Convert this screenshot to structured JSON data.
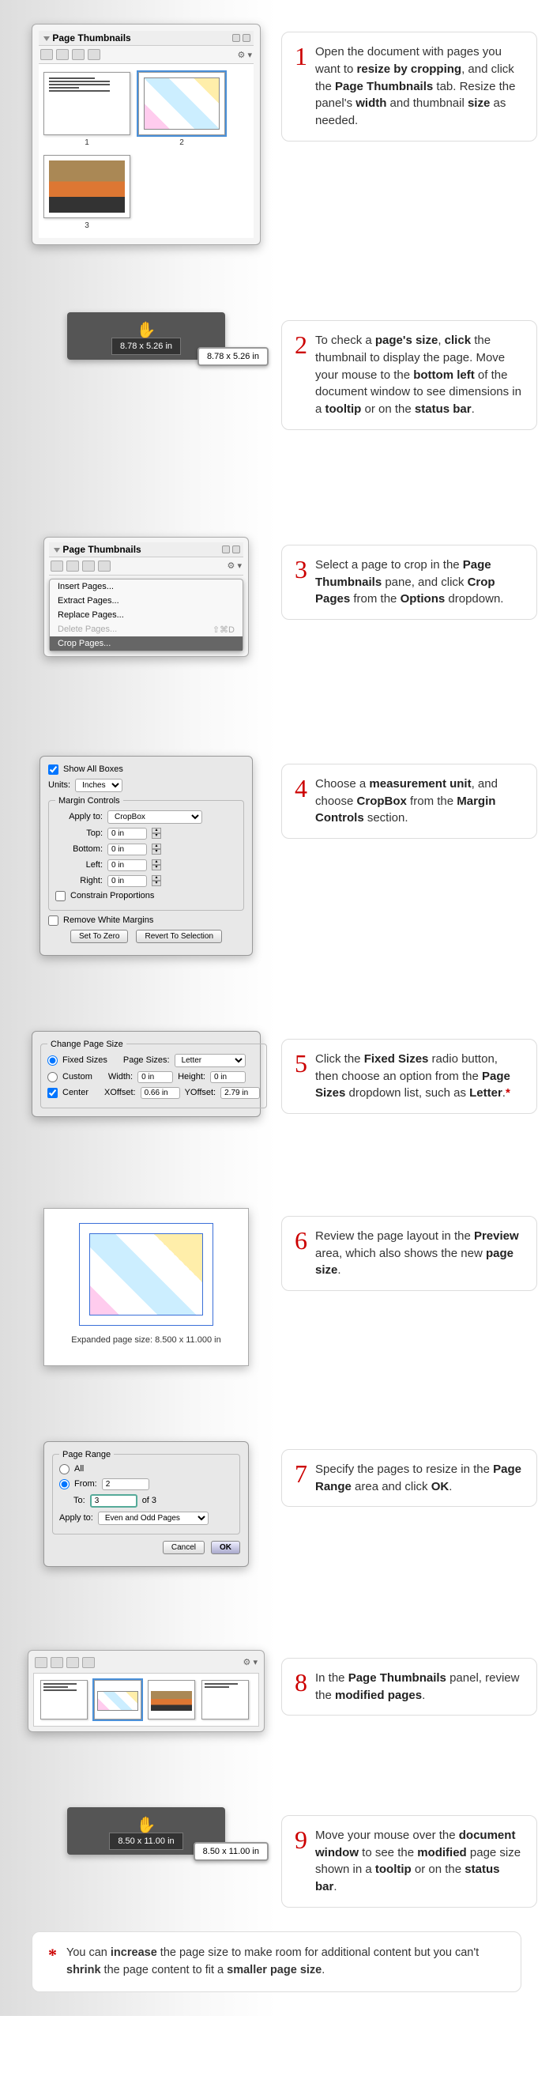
{
  "step1": {
    "panel_title": "Page Thumbnails",
    "thumb_labels": [
      "1",
      "2",
      "3"
    ],
    "text_parts": [
      "Open the document with pages you want to ",
      "resize by cropping",
      ", and click the ",
      "Page Thumbnails",
      " tab. Resize the panel's ",
      "width",
      " and thumbnail ",
      "size",
      " as needed."
    ]
  },
  "step2": {
    "status_size": "8.78 x 5.26 in",
    "tooltip_size": "8.78 x 5.26 in",
    "text_parts": [
      "To check a ",
      "page's size",
      ", ",
      "click",
      " the thumbnail to display the page. Move your mouse to the ",
      "bottom left",
      " of the document window to see dimensions in a ",
      "tooltip",
      " or on the ",
      "status bar",
      "."
    ]
  },
  "step3": {
    "panel_title": "Page Thumbnails",
    "menu_items": [
      "Insert Pages...",
      "Extract Pages...",
      "Replace Pages..."
    ],
    "menu_disabled": "Delete Pages...",
    "menu_shortcut": "⇧⌘D",
    "menu_highlight": "Crop Pages...",
    "text_parts": [
      "Select a page to crop in the ",
      "Page Thumbnails",
      " pane, and click ",
      "Crop Pages",
      " from the ",
      "Options",
      " dropdown."
    ]
  },
  "step4": {
    "checkbox_label": "Show All Boxes",
    "units_label": "Units:",
    "units_value": "Inches",
    "margin_legend": "Margin Controls",
    "apply_label": "Apply to:",
    "apply_value": "CropBox",
    "top_label": "Top:",
    "bottom_label": "Bottom:",
    "left_label": "Left:",
    "right_label": "Right:",
    "zero": "0 in",
    "constrain_label": "Constrain Proportions",
    "remove_white_label": "Remove White Margins",
    "btn_zero": "Set To Zero",
    "btn_revert": "Revert To Selection",
    "text_parts": [
      "Choose a ",
      "measurement unit",
      ", and choose ",
      "CropBox",
      " from the ",
      "Margin Controls",
      " section."
    ]
  },
  "step5": {
    "legend": "Change Page Size",
    "fixed_label": "Fixed Sizes",
    "page_sizes_label": "Page Sizes:",
    "page_sizes_value": "Letter",
    "custom_label": "Custom",
    "width_label": "Width:",
    "height_label": "Height:",
    "width_value": "0 in",
    "height_value": "0 in",
    "center_label": "Center",
    "xoffset_label": "XOffset:",
    "xoffset_value": "0.66 in",
    "yoffset_label": "YOffset:",
    "yoffset_value": "2.79 in",
    "text_parts": [
      "Click the ",
      "Fixed Sizes",
      " radio button, then choose an option from the ",
      "Page Sizes",
      " dropdown list, such as ",
      "Letter",
      "."
    ]
  },
  "step6": {
    "caption_label": "Expanded page size:",
    "caption_value": "8.500 x 11.000 in",
    "text_parts": [
      " Review the page layout in the ",
      "Preview",
      " area, which also shows the new ",
      "page size",
      "."
    ]
  },
  "step7": {
    "legend": "Page Range",
    "all_label": "All",
    "from_label": "From:",
    "from_value": "2",
    "to_label": "To:",
    "to_value": "3",
    "of_label": "of 3",
    "apply_label": "Apply to:",
    "apply_value": "Even and Odd Pages",
    "btn_cancel": "Cancel",
    "btn_ok": "OK",
    "text_parts": [
      "Specify the pages to resize in the ",
      "Page Range",
      " area and click ",
      "OK",
      "."
    ]
  },
  "step8": {
    "text_parts": [
      "In the ",
      "Page Thumbnails",
      " panel, review the ",
      "modified pages",
      "."
    ]
  },
  "step9": {
    "status_size": "8.50 x 11.00 in",
    "tooltip_size": "8.50 x 11.00 in",
    "text_parts": [
      "Move your mouse over the ",
      "document window",
      " to see the ",
      "modified",
      " page size shown in a ",
      "tooltip",
      " or on the ",
      "status bar",
      "."
    ]
  },
  "footnote": {
    "text_parts": [
      "You can ",
      "increase",
      " the page size to make room for additional content but you can't ",
      "shrink",
      " the page content to fit a ",
      "smaller page size",
      "."
    ]
  },
  "step_numbers": [
    "1",
    "2",
    "3",
    "4",
    "5",
    "6",
    "7",
    "8",
    "9"
  ]
}
